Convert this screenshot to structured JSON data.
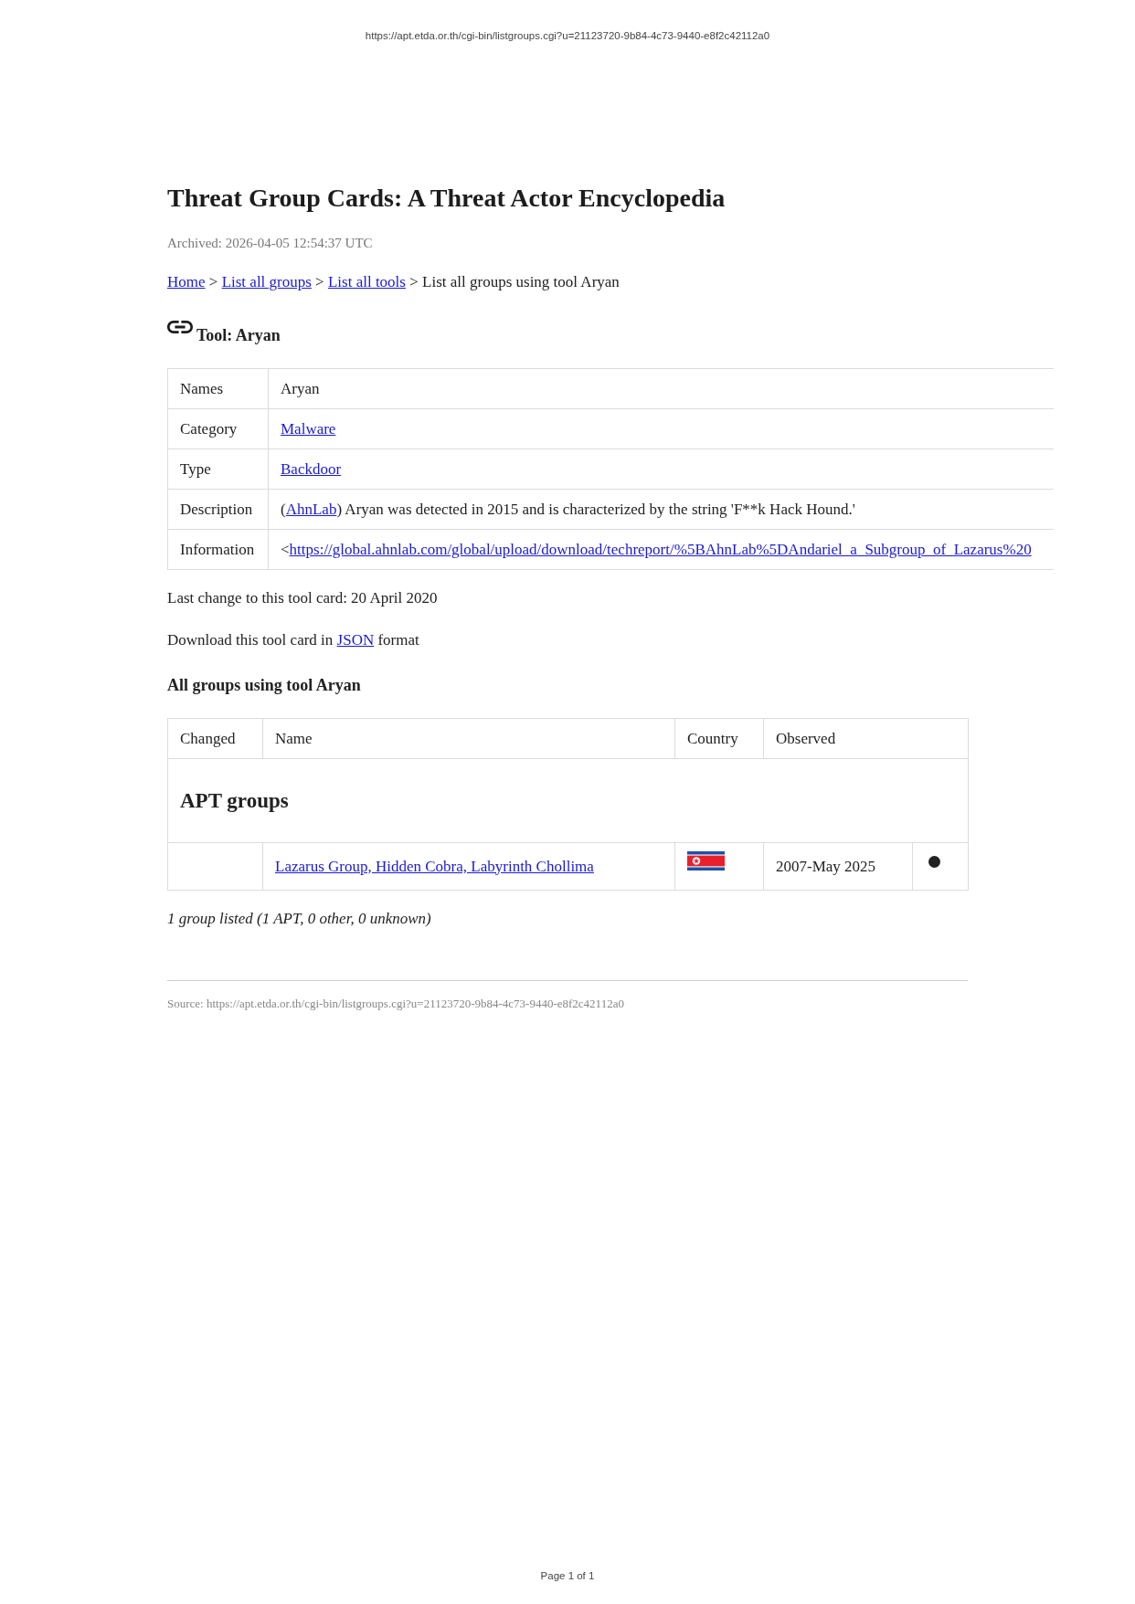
{
  "page_header": {
    "url": "https://apt.etda.or.th/cgi-bin/listgroups.cgi?u=21123720-9b84-4c73-9440-e8f2c42112a0"
  },
  "title": "Threat Group Cards: A Threat Actor Encyclopedia",
  "archived": "Archived: 2026-04-05 12:54:37 UTC",
  "breadcrumbs": [
    {
      "kind": "link",
      "text": "Home"
    },
    {
      "kind": "separator",
      "text": ">"
    },
    {
      "kind": "link",
      "text": "List all groups"
    },
    {
      "kind": "separator",
      "text": ">"
    },
    {
      "kind": "link",
      "text": "List all tools"
    },
    {
      "kind": "separator",
      "text": ">"
    },
    {
      "kind": "current",
      "text": "List all groups using tool Aryan"
    }
  ],
  "tool_heading": "Tool: Aryan",
  "tool_table": {
    "rows": [
      {
        "label": "Names",
        "value": [
          {
            "kind": "text",
            "text": "Aryan"
          }
        ]
      },
      {
        "label": "Category",
        "value": [
          {
            "kind": "link",
            "text": "Malware"
          }
        ]
      },
      {
        "label": "Type",
        "value": [
          {
            "kind": "link",
            "text": "Backdoor"
          }
        ]
      },
      {
        "label": "Description",
        "value": [
          {
            "kind": "text",
            "text": "("
          },
          {
            "kind": "link",
            "text": "AhnLab"
          },
          {
            "kind": "text",
            "text": ") Aryan was detected in 2015 and is characterized by the string 'F**k Hack Hound.'"
          }
        ]
      },
      {
        "label": "Information",
        "value": [
          {
            "kind": "text",
            "text": "<"
          },
          {
            "kind": "link",
            "text": "https://global.ahnlab.com/global/upload/download/techreport/%5BAhnLab%5DAndariel_a_Subgroup_of_Lazarus%20"
          }
        ]
      }
    ]
  },
  "last_change": "Last change to this tool card: 20 April 2020",
  "download": [
    {
      "kind": "text",
      "text": "Download this tool card in "
    },
    {
      "kind": "link",
      "text": "JSON"
    },
    {
      "kind": "text",
      "text": " format"
    }
  ],
  "groups_heading": "All groups using tool Aryan",
  "groups_table": {
    "columns": [
      "Changed",
      "Name",
      "Country",
      "Observed"
    ],
    "sections": [
      {
        "title": "APT groups",
        "rows": [
          {
            "name": "Lazarus Group, Hidden Cobra, Labyrinth Chollima",
            "observed": "2007-May 2025",
            "color": "#222222"
          }
        ]
      }
    ]
  },
  "summary": "1 group listed (1 APT, 0 other, 0 unknown)",
  "source": "Source: https://apt.etda.or.th/cgi-bin/listgroups.cgi?u=21123720-9b84-4c73-9440-e8f2c42112a0",
  "page_footer": "Page 1 of 1"
}
